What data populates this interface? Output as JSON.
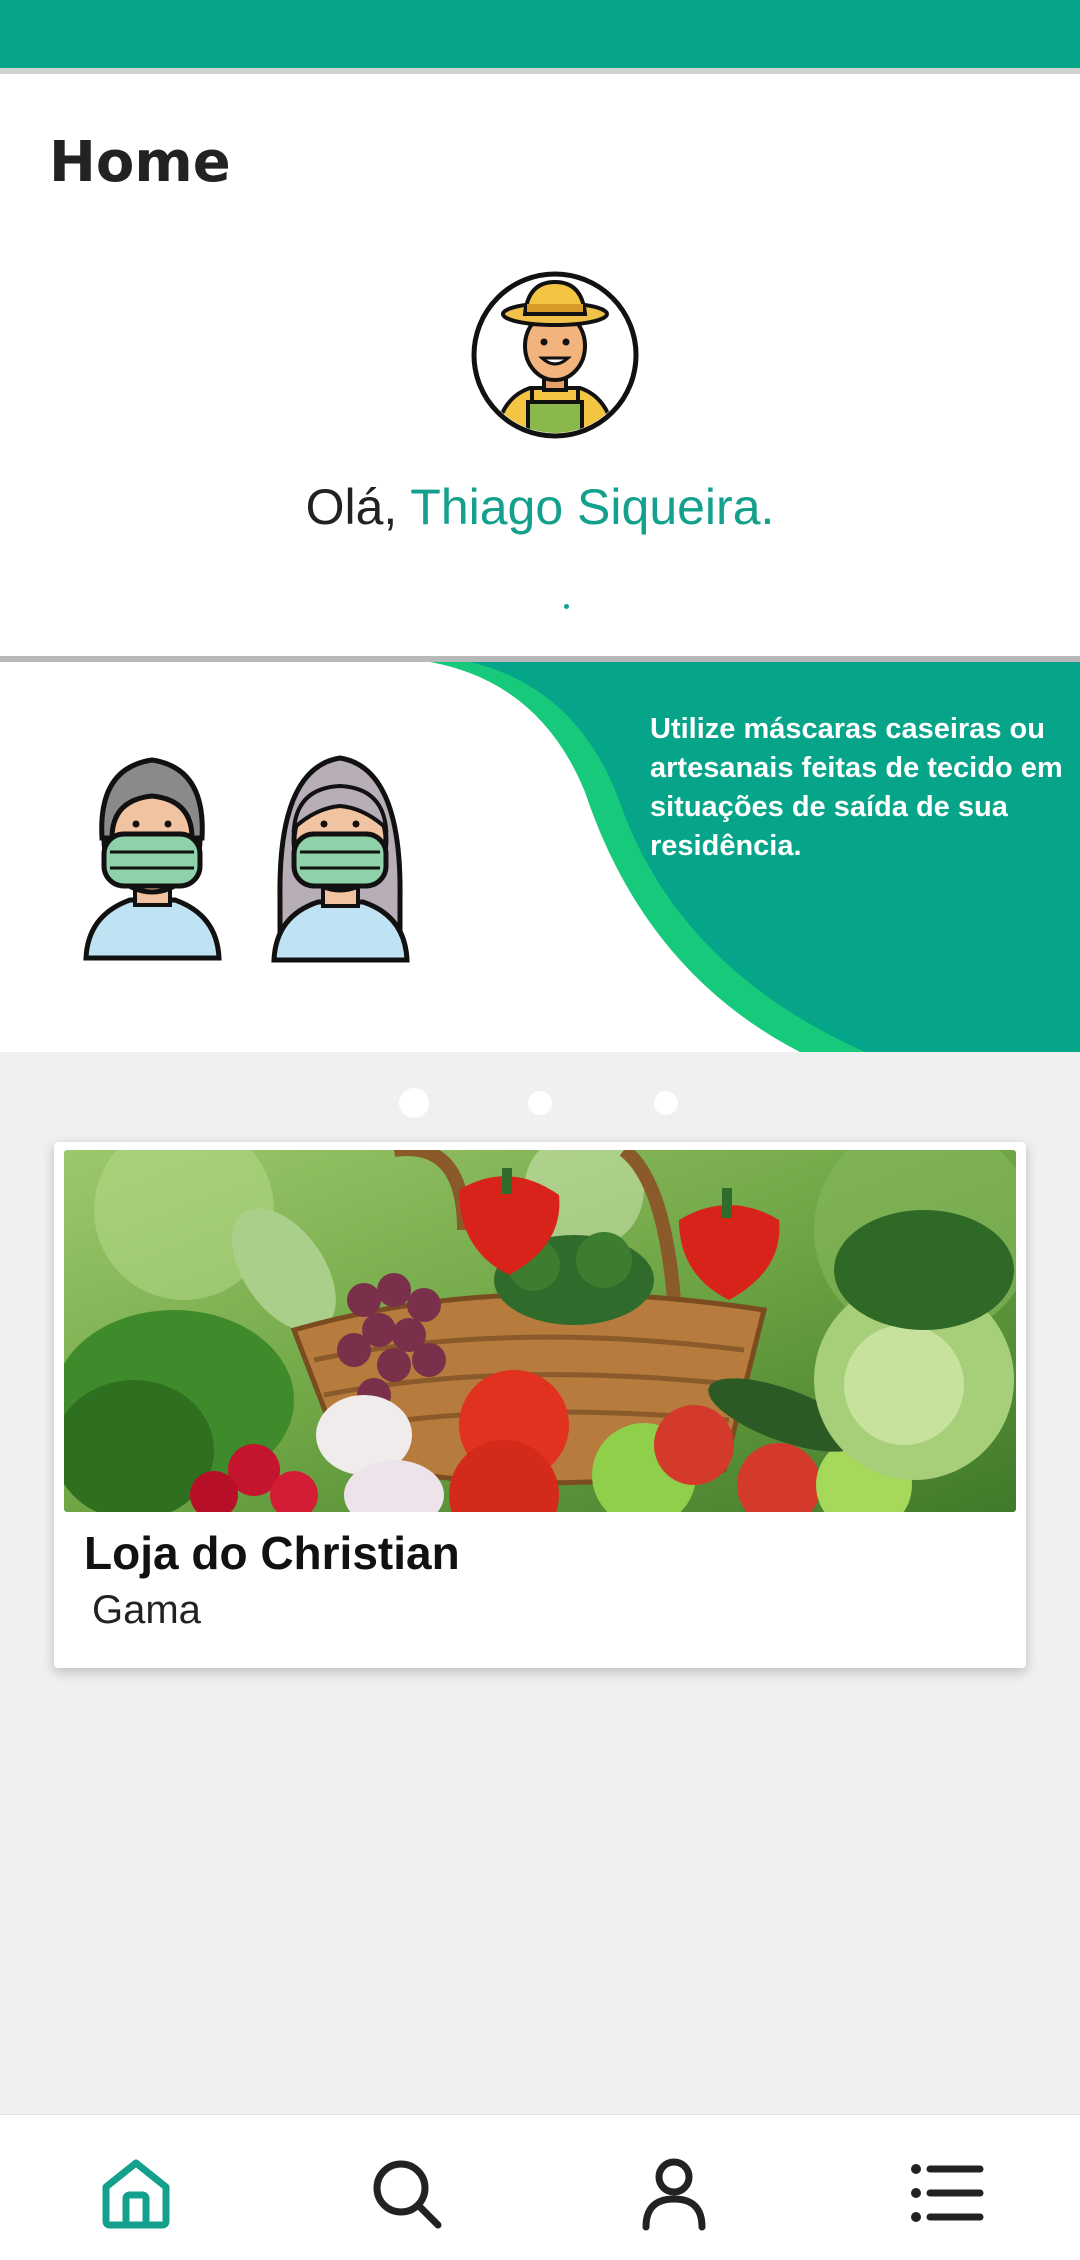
{
  "header": {
    "title": "Home"
  },
  "greeting": {
    "prefix": "Olá, ",
    "user_name": "Thiago Siqueira.",
    "avatar_icon": "farmer-avatar-icon"
  },
  "banner": {
    "text": "Utilize máscaras caseiras ou  artesanais feitas de tecido em situações de saída de sua residência.",
    "illustration": "masked-people-icon"
  },
  "carousel": {
    "count": 3,
    "active_index": 0
  },
  "stores": [
    {
      "name": "Loja do Christian",
      "location": "Gama",
      "image": "vegetable-basket-image"
    }
  ],
  "bottom_nav": {
    "items": [
      {
        "icon": "home-icon",
        "active": true
      },
      {
        "icon": "search-icon",
        "active": false
      },
      {
        "icon": "user-icon",
        "active": false
      },
      {
        "icon": "list-icon",
        "active": false
      }
    ]
  },
  "colors": {
    "primary": "#06a58a",
    "accent_text": "#13a08c",
    "wave_light": "#17c97a",
    "nav_active": "#13a08c",
    "nav_inactive": "#222222"
  }
}
